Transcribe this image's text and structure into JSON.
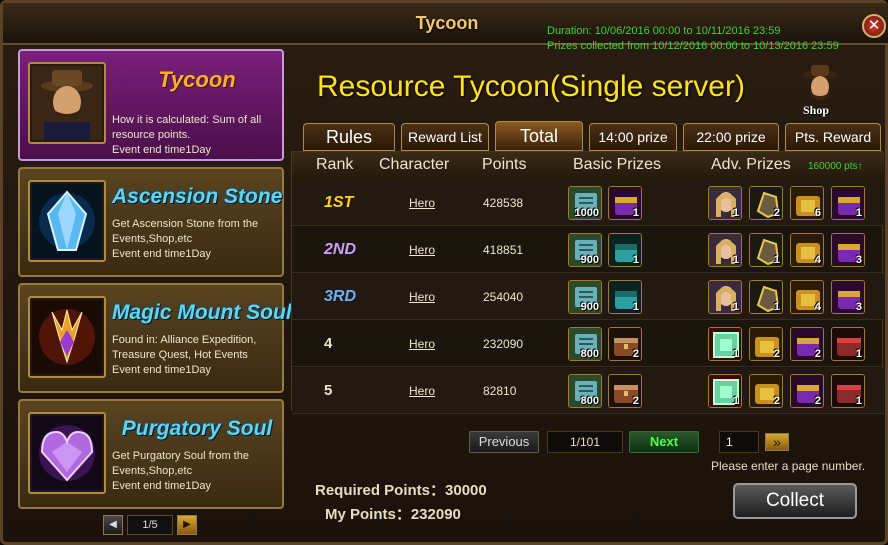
{
  "window": {
    "title": "Tycoon",
    "close_label": "✕"
  },
  "duration": {
    "line1": "Duration: 10/06/2016 00:00 to 10/11/2016 23:59",
    "line2": "Prizes collected from 10/12/2016 00:00 to 10/13/2016 23:59"
  },
  "events": [
    {
      "title": "Tycoon",
      "desc": "How it is calculated: Sum of all resource points.",
      "end": "Event end time1Day",
      "icon": "tycoon-portrait-icon",
      "active": true
    },
    {
      "title": "Ascension Stone",
      "desc": "Get Ascension Stone from the Events,Shop,etc",
      "end": "Event end time1Day",
      "icon": "crystal-icon",
      "active": false
    },
    {
      "title": "Magic Mount Soul",
      "desc": "Found in: Alliance Expedition, Treasure Quest, Hot Events",
      "end": "Event end time1Day",
      "icon": "mount-soul-icon",
      "active": false
    },
    {
      "title": "Purgatory Soul",
      "desc": "Get Purgatory Soul from the Events,Shop,etc",
      "end": "Event end time1Day",
      "icon": "purgatory-gem-icon",
      "active": false
    }
  ],
  "left_pager": {
    "page": "1/5",
    "prev": "◀",
    "next": "▶"
  },
  "heading": "Resource Tycoon(Single server)",
  "shop_label": "Shop",
  "tabs": [
    "Rules",
    "Reward List",
    "Total",
    "14:00 prize",
    "22:00 prize",
    "Pts. Reward"
  ],
  "active_tab": "Total",
  "table": {
    "headers": {
      "rank": "Rank",
      "character": "Character",
      "points": "Points",
      "basic": "Basic Prizes",
      "adv": "Adv. Prizes"
    },
    "pts_note": "160000 pts↑",
    "rows": [
      {
        "rank": "1ST",
        "character": "Hero",
        "points": "428538",
        "basic": [
          {
            "icon": "scroll-icon",
            "qty": "1000"
          },
          {
            "icon": "purple-chest-icon",
            "qty": "1"
          }
        ],
        "adv": [
          {
            "icon": "hero-portrait-icon",
            "qty": "1"
          },
          {
            "icon": "gear-shard-icon",
            "qty": "2"
          },
          {
            "icon": "gold-chest-icon",
            "qty": "6"
          },
          {
            "icon": "purple-chest-icon",
            "qty": "1"
          }
        ]
      },
      {
        "rank": "2ND",
        "character": "Hero",
        "points": "418851",
        "basic": [
          {
            "icon": "scroll-icon",
            "qty": "900"
          },
          {
            "icon": "teal-chest-icon",
            "qty": "1"
          }
        ],
        "adv": [
          {
            "icon": "hero-portrait-icon",
            "qty": "1"
          },
          {
            "icon": "gear-shard-icon",
            "qty": "1"
          },
          {
            "icon": "gold-chest-icon",
            "qty": "4"
          },
          {
            "icon": "purple-chest-icon",
            "qty": "3"
          }
        ]
      },
      {
        "rank": "3RD",
        "character": "Hero",
        "points": "254040",
        "basic": [
          {
            "icon": "scroll-icon",
            "qty": "900"
          },
          {
            "icon": "teal-chest-icon",
            "qty": "1"
          }
        ],
        "adv": [
          {
            "icon": "hero-portrait-icon",
            "qty": "1"
          },
          {
            "icon": "gear-shard-icon",
            "qty": "1"
          },
          {
            "icon": "gold-chest-icon",
            "qty": "4"
          },
          {
            "icon": "purple-chest-icon",
            "qty": "3"
          }
        ]
      },
      {
        "rank": "4",
        "character": "Hero",
        "points": "232090",
        "basic": [
          {
            "icon": "scroll-icon",
            "qty": "800"
          },
          {
            "icon": "treasure-chest-icon",
            "qty": "2"
          }
        ],
        "adv": [
          {
            "icon": "green-gem-icon",
            "qty": "1"
          },
          {
            "icon": "gold-chest-icon",
            "qty": "2"
          },
          {
            "icon": "purple-chest-icon",
            "qty": "2"
          },
          {
            "icon": "red-chest-icon",
            "qty": "1"
          }
        ]
      },
      {
        "rank": "5",
        "character": "Hero",
        "points": "82810",
        "basic": [
          {
            "icon": "scroll-icon",
            "qty": "800"
          },
          {
            "icon": "treasure-chest-icon",
            "qty": "2"
          }
        ],
        "adv": [
          {
            "icon": "green-gem-icon",
            "qty": "1"
          },
          {
            "icon": "gold-chest-icon",
            "qty": "2"
          },
          {
            "icon": "purple-chest-icon",
            "qty": "2"
          },
          {
            "icon": "red-chest-icon",
            "qty": "1"
          }
        ]
      }
    ]
  },
  "pager": {
    "prev": "Previous",
    "page": "1/101",
    "next": "Next",
    "input_value": "1",
    "go": "»",
    "hint": "Please enter a page number."
  },
  "required_points": "Required Points：30000",
  "my_points": "My Points：232090",
  "collect_label": "Collect",
  "colors": {
    "accent_yellow": "#ffe21a",
    "green_text": "#3fd13f",
    "tycoon_purple": "#7a1f7a"
  }
}
